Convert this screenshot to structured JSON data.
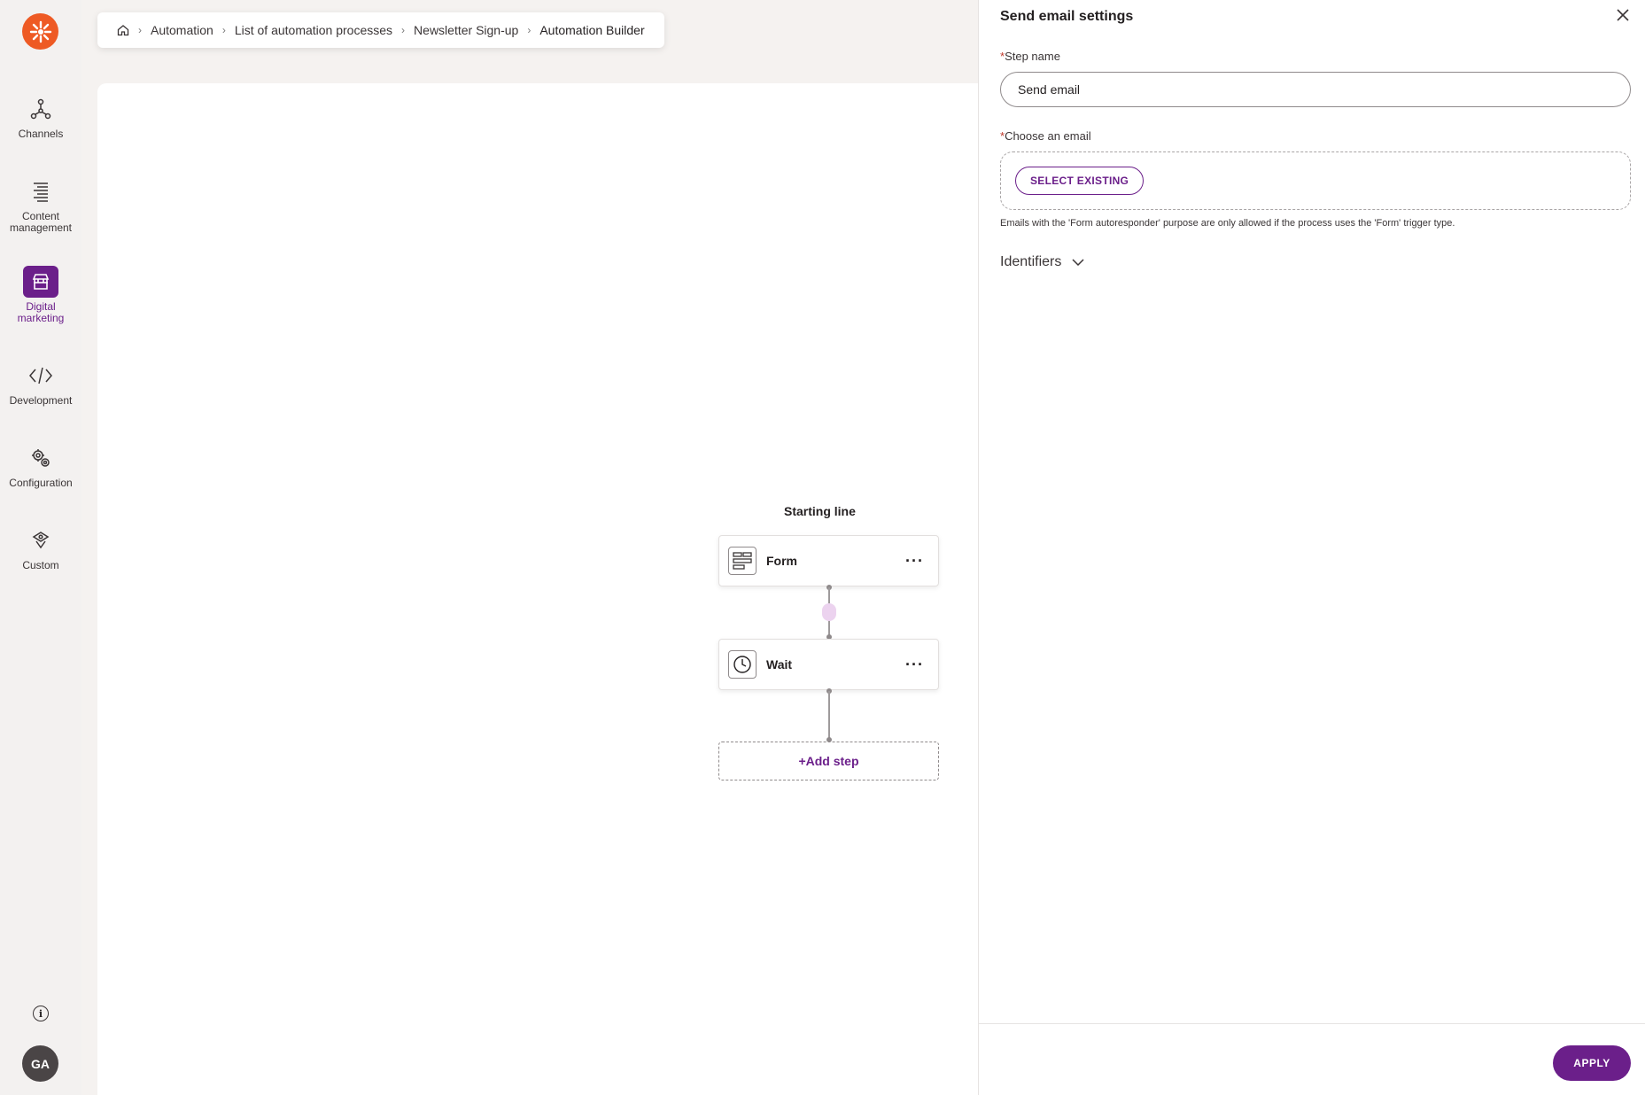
{
  "colors": {
    "brand": "#ee5a24",
    "accent": "#6b1f8a",
    "background": "#f5f2f0"
  },
  "nav": {
    "logo_icon": "kentico-logo-icon",
    "items": [
      {
        "label": "Channels",
        "icon": "channels-icon"
      },
      {
        "label": "Content management",
        "icon": "content-list-icon"
      },
      {
        "label": "Digital marketing",
        "icon": "store-icon",
        "active": true
      },
      {
        "label": "Development",
        "icon": "code-icon"
      },
      {
        "label": "Configuration",
        "icon": "cogwheels-icon"
      },
      {
        "label": "Custom",
        "icon": "custom-puzzle-icon"
      }
    ],
    "avatar_initials": "GA"
  },
  "breadcrumb": {
    "items": [
      "Automation",
      "List of automation processes",
      "Newsletter Sign-up"
    ],
    "current": "Automation Builder"
  },
  "builder": {
    "starting_line": "Starting line",
    "steps": [
      {
        "label": "Form",
        "icon": "form-icon"
      },
      {
        "label": "Wait",
        "icon": "clock-icon"
      }
    ],
    "add_step": "+Add step"
  },
  "panel": {
    "title": "Send email settings",
    "step_name_label": "Step name",
    "step_name_value": "Send email",
    "choose_email_label": "Choose an email",
    "select_existing": "SELECT EXISTING",
    "hint": "Emails with the 'Form autoresponder' purpose are only allowed if the process uses the 'Form' trigger type.",
    "identifiers": "Identifiers",
    "apply": "APPLY"
  }
}
